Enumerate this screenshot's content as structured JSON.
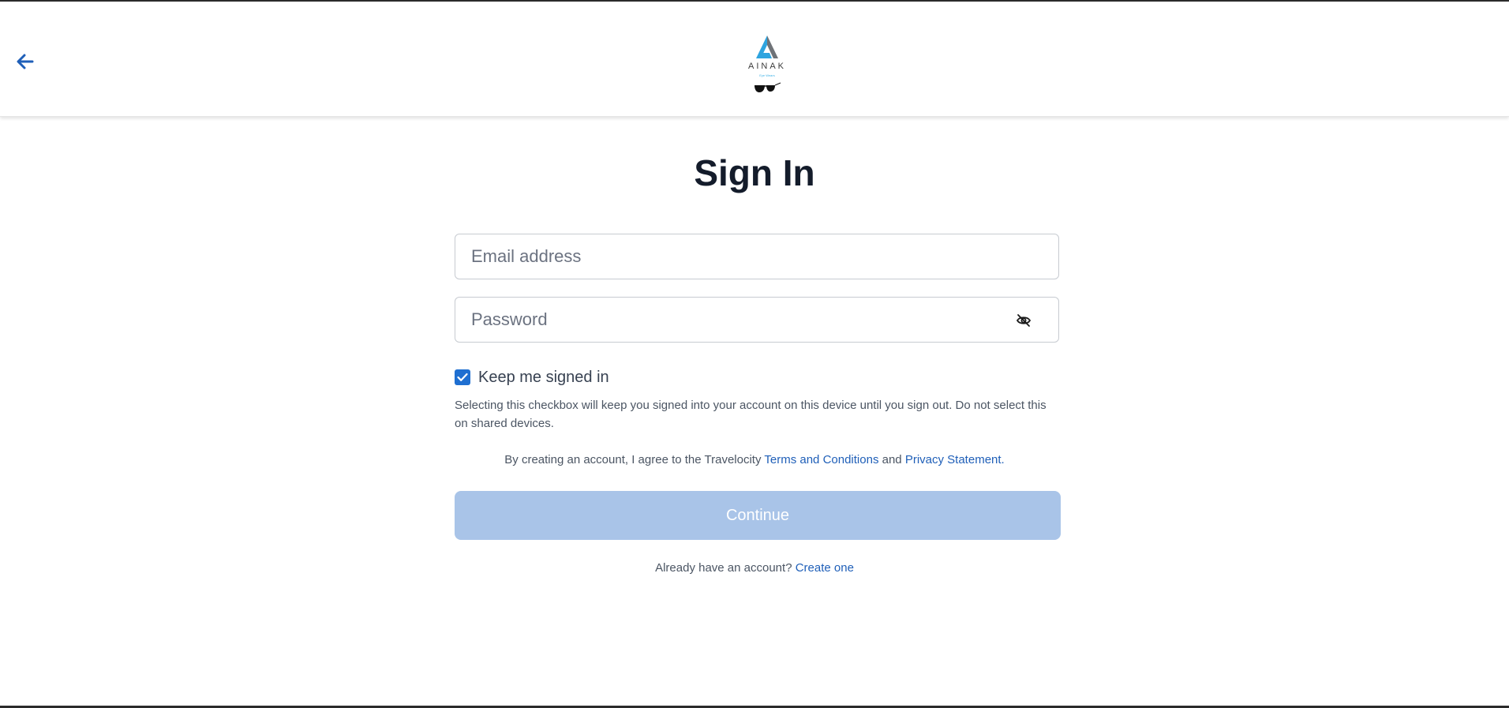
{
  "header": {
    "back_icon": "arrow-left-icon",
    "logo": {
      "name": "AINAK",
      "tagline": "Eye Wears"
    }
  },
  "main": {
    "title": "Sign In",
    "email": {
      "placeholder": "Email address",
      "value": ""
    },
    "password": {
      "placeholder": "Password",
      "value": "",
      "toggle_icon": "eye-slash-icon"
    },
    "keep_signed_in": {
      "label": "Keep me signed in",
      "checked": true
    },
    "help_text": "Selecting this checkbox will keep you signed into your account on this device until you sign out. Do not select this on shared devices.",
    "agreement": {
      "prefix": "By creating an account, I agree to the Travelocity",
      "terms_link": "Terms and Conditions",
      "conjunction": "and",
      "privacy_link": "Privacy Statement",
      "suffix": "."
    },
    "continue_label": "Continue",
    "account_prompt": {
      "text": "Already have an account?",
      "link": "Create one"
    }
  },
  "colors": {
    "accent": "#1f6fd1",
    "link": "#1f5fb8",
    "button_disabled": "#a9c4e8",
    "title": "#141c2b"
  }
}
